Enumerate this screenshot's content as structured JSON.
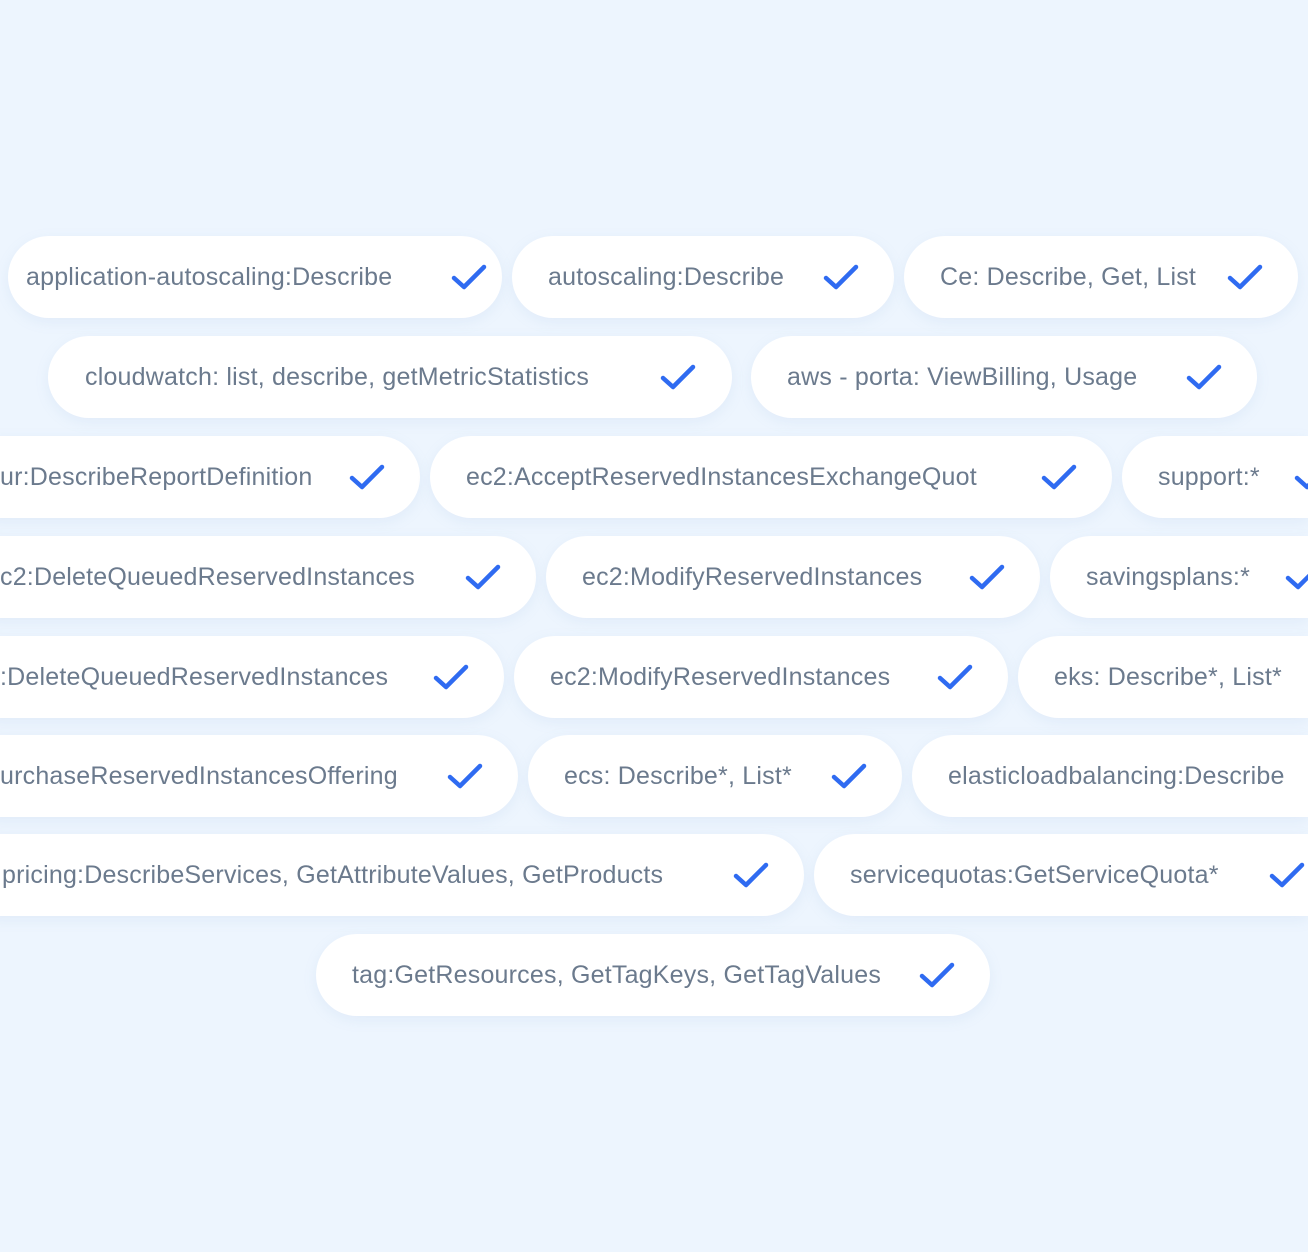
{
  "accent_color": "#2f6bf1",
  "background_color": "#edf5fe",
  "permissions": [
    {
      "label": "application-autoscaling:Describe",
      "icon": "check-icon"
    },
    {
      "label": "autoscaling:Describe",
      "icon": "check-icon"
    },
    {
      "label": "Ce: Describe, Get, List",
      "icon": "check-icon"
    },
    {
      "label": "cloudwatch: list, describe, getMetricStatistics",
      "icon": "check-icon"
    },
    {
      "label": "aws - porta: ViewBilling, Usage",
      "icon": "check-icon"
    },
    {
      "label": "ur:DescribeReportDefinition",
      "icon": "check-icon"
    },
    {
      "label": "ec2:AcceptReservedInstancesExchangeQuot",
      "icon": "check-icon"
    },
    {
      "label": "support:*",
      "icon": "check-icon"
    },
    {
      "label": "c2:DeleteQueuedReservedInstances",
      "icon": "check-icon"
    },
    {
      "label": "ec2:ModifyReservedInstances",
      "icon": "check-icon"
    },
    {
      "label": "savingsplans:*",
      "icon": "check-icon"
    },
    {
      "label": ":DeleteQueuedReservedInstances",
      "icon": "check-icon"
    },
    {
      "label": "ec2:ModifyReservedInstances",
      "icon": "check-icon"
    },
    {
      "label": "eks: Describe*, List*",
      "icon": "check-icon"
    },
    {
      "label": "urchaseReservedInstancesOffering",
      "icon": "check-icon"
    },
    {
      "label": "ecs: Describe*, List*",
      "icon": "check-icon"
    },
    {
      "label": "elasticloadbalancing:Describe",
      "icon": "check-icon"
    },
    {
      "label": "pricing:DescribeServices, GetAttributeValues, GetProducts",
      "icon": "check-icon"
    },
    {
      "label": "servicequotas:GetServiceQuota*",
      "icon": "check-icon"
    },
    {
      "label": "tag:GetResources, GetTagKeys, GetTagValues",
      "icon": "check-icon"
    }
  ]
}
